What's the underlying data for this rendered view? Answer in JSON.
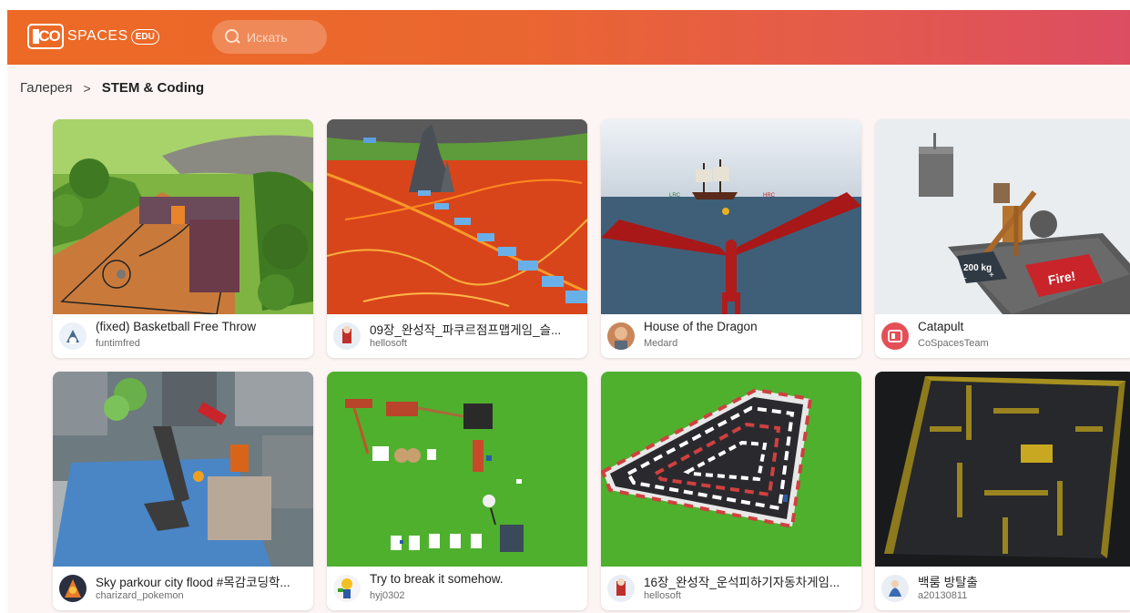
{
  "header": {
    "logo": {
      "co": "CO",
      "spaces": "SPACES",
      "edu": "EDU"
    },
    "search": {
      "placeholder": "Искать"
    }
  },
  "breadcrumb": {
    "root": "Галерея",
    "separator": ">",
    "current": "STEM & Coding"
  },
  "cards": [
    {
      "title": "(fixed) Basketball Free Throw",
      "author": "funtimfred"
    },
    {
      "title": "09장_완성작_파쿠르점프맵게임_슬...",
      "author": "hellosoft"
    },
    {
      "title": "House of the Dragon",
      "author": "Medard"
    },
    {
      "title": "Catapult",
      "author": "CoSpacesTeam"
    },
    {
      "title": "Sky parkour city flood #목감코딩학...",
      "author": "charizard_pokemon"
    },
    {
      "title": "Try to break it somehow.",
      "author": "hyj0302"
    },
    {
      "title": "16장_완성작_운석피하기자동차게임...",
      "author": "hellosoft"
    },
    {
      "title": "백룸 방탈출",
      "author": "a20130811"
    }
  ],
  "thumb_labels": {
    "dragon_left": "LRC",
    "dragon_right": "HRC",
    "catapult_value": "200 kg",
    "catapult_minus": "−",
    "catapult_plus": "+",
    "catapult_fire": "Fire!"
  }
}
